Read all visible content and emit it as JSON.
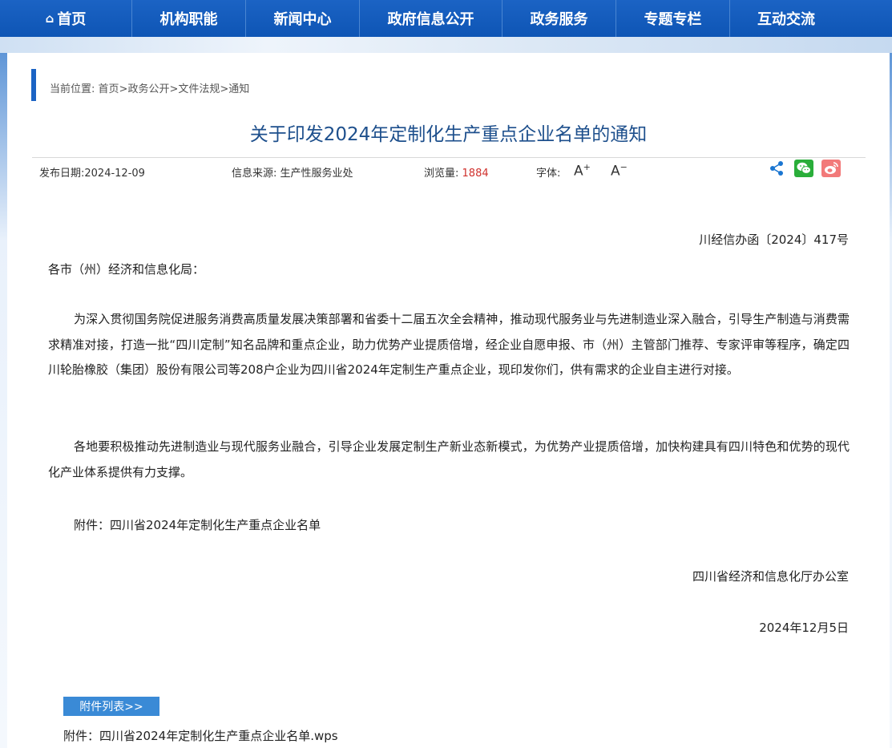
{
  "nav": {
    "items": [
      {
        "label": "首页",
        "icon": "home-icon",
        "width": 165
      },
      {
        "label": "机构职能",
        "width": 142
      },
      {
        "label": "新闻中心",
        "width": 142
      },
      {
        "label": "政府信息公开",
        "width": 178
      },
      {
        "label": "政务服务",
        "width": 142
      },
      {
        "label": "专题专栏",
        "width": 142
      },
      {
        "label": "互动交流",
        "width": 140
      }
    ]
  },
  "breadcrumb": {
    "prefix": "当前位置:",
    "items": [
      "首页",
      "政务公开",
      "文件法规",
      "通知"
    ],
    "separator": ">"
  },
  "article": {
    "title": "关于印发2024年定制化生产重点企业名单的通知",
    "publish_date_label": "发布日期:",
    "publish_date": "2024-12-09",
    "source_label": "信息来源:",
    "source": "生产性服务业处",
    "views_label": "浏览量:",
    "views": "1884",
    "font_label": "字体:",
    "font_increase": "A",
    "font_decrease": "A",
    "doc_number": "川经信办函〔2024〕417号",
    "salutation": "各市（州）经济和信息化局：",
    "paragraph1": "为深入贯彻国务院促进服务消费高质量发展决策部署和省委十二届五次全会精神，推动现代服务业与先进制造业深入融合，引导生产制造与消费需求精准对接，打造一批“四川定制”知名品牌和重点企业，助力优势产业提质倍增，经企业自愿申报、市（州）主管部门推荐、专家评审等程序，确定四川轮胎橡胶（集团）股份有限公司等208户企业为四川省2024年定制生产重点企业，现印发你们，供有需求的企业自主进行对接。",
    "paragraph2": "各地要积极推动先进制造业与现代服务业融合，引导企业发展定制生产新业态新模式，为优势产业提质倍增，加快构建具有四川特色和优势的现代化产业体系提供有力支撑。",
    "attachment_line": "附件：四川省2024年定制化生产重点企业名单",
    "signer": "四川省经济和信息化厅办公室",
    "sign_date": "2024年12月5日"
  },
  "attachments": {
    "header": "附件列表>>",
    "file_prefix": "附件：",
    "file_name": "四川省2024年定制化生产重点企业名单.wps"
  }
}
